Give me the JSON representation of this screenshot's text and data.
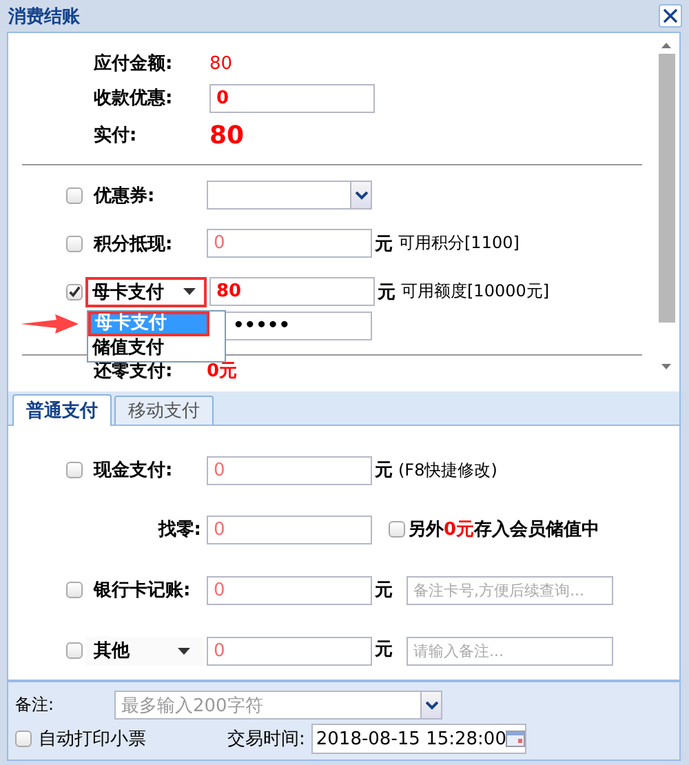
{
  "window": {
    "title": "消费结账"
  },
  "summary": [
    {
      "kind": "text",
      "label": "应付金额:",
      "value": "80"
    },
    {
      "kind": "input",
      "label": "收款优惠:",
      "value": "0"
    },
    {
      "kind": "big",
      "label": "实付:",
      "value": "80"
    }
  ],
  "deductions": [
    {
      "kind": "select",
      "label": "优惠券:",
      "checked": false
    },
    {
      "kind": "amount",
      "label": "积分抵现:",
      "checked": false,
      "value": "0",
      "unit": "元",
      "note": "可用积分[1100]"
    },
    {
      "kind": "card",
      "checked": true,
      "method": "母卡支付",
      "value": "80",
      "unit": "元",
      "note": "可用额度[10000元]",
      "password": "•••••",
      "options": [
        {
          "label": "母卡支付",
          "selected": true
        },
        {
          "label": "储值支付",
          "selected": false
        }
      ]
    }
  ],
  "change_pay": {
    "label": "还零支付:",
    "value": "0元"
  },
  "tabs": [
    {
      "label": "普通支付",
      "selected": true
    },
    {
      "label": "移动支付",
      "selected": false
    }
  ],
  "payments": [
    {
      "kind": "cash",
      "label": "现金支付:",
      "checked": false,
      "value": "0",
      "unit": "元",
      "hint": "(F8快捷修改)"
    },
    {
      "kind": "change",
      "label": "找零:",
      "value": "0",
      "store_checked": false,
      "store_prefix": "另外",
      "store_amount": "0元",
      "store_suffix": "存入会员储值中"
    },
    {
      "kind": "remark",
      "label": "银行卡记账:",
      "checked": false,
      "value": "0",
      "unit": "元",
      "placeholder": "备注卡号,方便后续查询..."
    },
    {
      "kind": "select-remark",
      "label": "其他",
      "checked": false,
      "value": "0",
      "unit": "元",
      "placeholder": "请输入备注..."
    }
  ],
  "footer": {
    "remark_label": "备注:",
    "remark_placeholder": "最多输入200字符",
    "auto_print": {
      "label": "自动打印小票",
      "checked": false
    },
    "time_label": "交易时间:",
    "time_value": "2018-08-15 15:28:00"
  }
}
